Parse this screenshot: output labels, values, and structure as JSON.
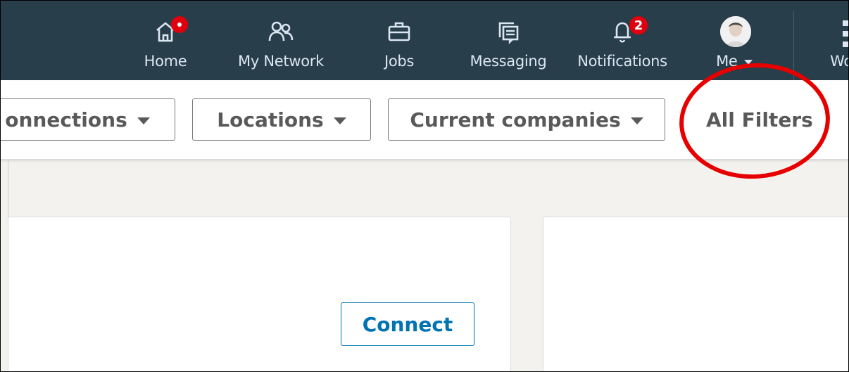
{
  "nav": {
    "items": [
      {
        "label": "Home",
        "icon": "home-icon"
      },
      {
        "label": "My Network",
        "icon": "network-icon"
      },
      {
        "label": "Jobs",
        "icon": "briefcase-icon"
      },
      {
        "label": "Messaging",
        "icon": "messaging-icon"
      },
      {
        "label": "Notifications",
        "icon": "bell-icon"
      },
      {
        "label": "Me",
        "icon": "avatar"
      },
      {
        "label": "Wo",
        "icon": "grid-icon"
      }
    ],
    "home_badge": "dot",
    "notifications_count": "2"
  },
  "filters": {
    "connections_label": "onnections",
    "locations_label": "Locations",
    "current_companies_label": "Current companies",
    "all_filters_label": "All Filters"
  },
  "results": {
    "connect_label": "Connect"
  },
  "colors": {
    "nav_bg": "#283e4a",
    "accent": "#0073b1",
    "badge": "#e0000d",
    "annotation": "#e60000"
  }
}
